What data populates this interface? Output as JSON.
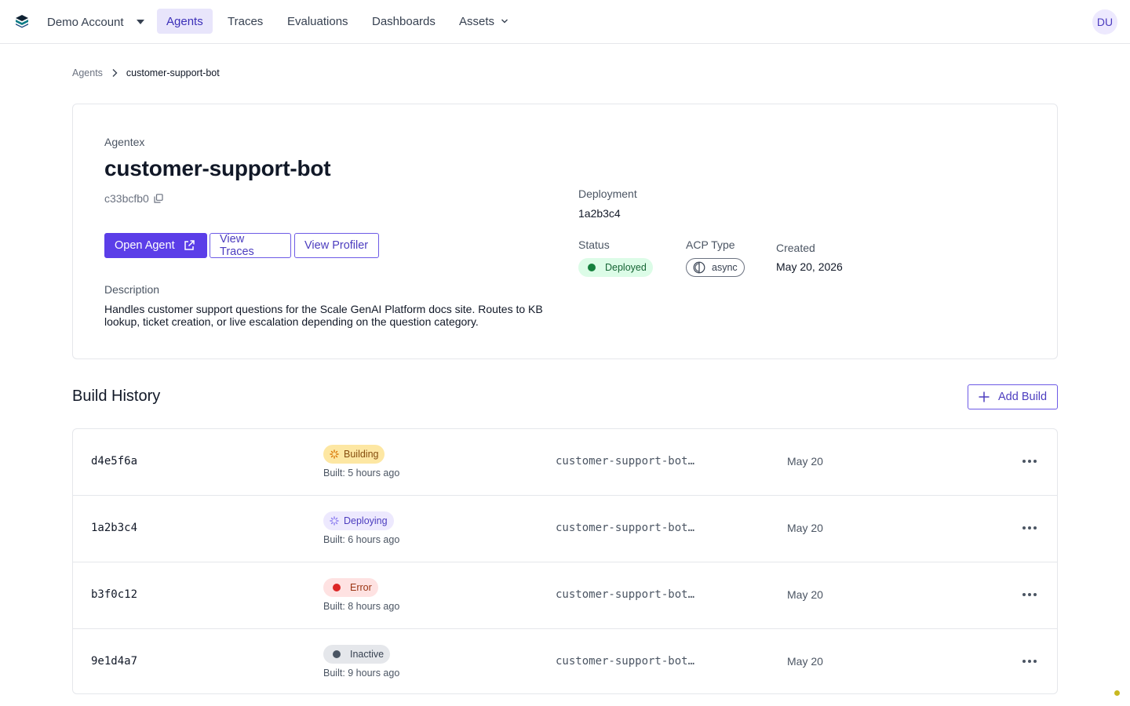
{
  "nav": {
    "account": "Demo Account",
    "links": [
      "Agents",
      "Traces",
      "Evaluations",
      "Dashboards",
      "Assets"
    ],
    "active": "Agents",
    "avatar": "DU"
  },
  "breadcrumb": {
    "parent": "Agents",
    "current": "customer-support-bot"
  },
  "agent": {
    "eyebrow": "Agentex",
    "name": "customer-support-bot",
    "id": "c33bcfb0",
    "buttons": {
      "open": "Open Agent",
      "traces": "View Traces",
      "profiler": "View Profiler"
    },
    "description_label": "Description",
    "description": "Handles customer support questions for the Scale GenAI Platform docs site. Routes to KB lookup, ticket creation, or live escalation depending on the question category.",
    "deployment_label": "Deployment",
    "deployment": "1a2b3c4",
    "status_label": "Status",
    "status": "Deployed",
    "acp_label": "ACP Type",
    "acp": "async",
    "created_label": "Created",
    "created": "May 20, 2026"
  },
  "build_history": {
    "title": "Build History",
    "add_label": "Add Build",
    "rows": [
      {
        "id": "d4e5f6a",
        "status": "Building",
        "built": "Built: 5 hours ago",
        "image": "customer-support-bot…",
        "date": "May 20"
      },
      {
        "id": "1a2b3c4",
        "status": "Deploying",
        "built": "Built: 6 hours ago",
        "image": "customer-support-bot…",
        "date": "May 20"
      },
      {
        "id": "b3f0c12",
        "status": "Error",
        "built": "Built: 8 hours ago",
        "image": "customer-support-bot…",
        "date": "May 20"
      },
      {
        "id": "9e1d4a7",
        "status": "Inactive",
        "built": "Built: 9 hours ago",
        "image": "customer-support-bot…",
        "date": "May 20"
      }
    ]
  },
  "colors": {
    "accent": "#5b3ee8",
    "active_nav_bg": "#e8e5fb",
    "deployed_bg": "#dcfce7",
    "deployed_dot": "#15803d",
    "building_bg": "#fde7a3",
    "deploying_bg": "#ede9fe",
    "error_bg": "#fee2e2",
    "error_dot": "#dc2626",
    "inactive_bg": "#e5e7eb",
    "inactive_dot": "#4b5563"
  },
  "icons": {
    "logo": "stacked-layers-logo",
    "external": "external-link-icon",
    "copy": "copy-icon",
    "add": "plus-icon",
    "menu": "more-horizontal-icon"
  }
}
